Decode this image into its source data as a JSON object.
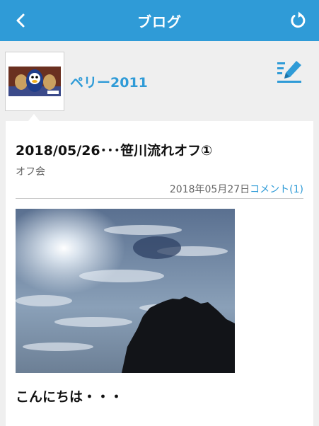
{
  "header": {
    "title": "ブログ"
  },
  "profile": {
    "blog_name": "ペリー2011"
  },
  "post": {
    "title": "2018/05/26･･･笹川流れオフ①",
    "category": "オフ会",
    "date": "2018年05月27日",
    "comment_link": "コメント(1)",
    "greeting": "こんにちは・・・"
  },
  "colors": {
    "accent": "#2f9bd7",
    "background": "#efefef"
  },
  "icons": {
    "back": "chevron-left-icon",
    "reload": "reload-icon",
    "edit": "write-post-icon"
  }
}
